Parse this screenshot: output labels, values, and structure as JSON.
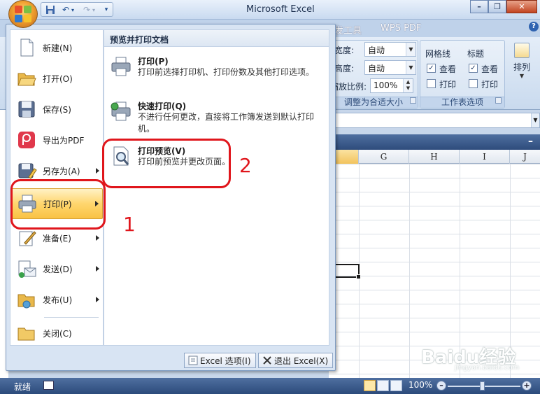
{
  "window": {
    "title": "Microsoft Excel"
  },
  "ribbon": {
    "tabs": [
      "发工具",
      "WPS PDF"
    ],
    "page_setup": {
      "width_label": "宽度:",
      "width_value": "自动",
      "height_label": "高度:",
      "height_value": "自动",
      "scale_label": "缩放比例:",
      "scale_value": "100%",
      "group_label": "调整为合适大小"
    },
    "sheet_options": {
      "gridlines_label": "网格线",
      "headings_label": "标题",
      "view_label": "查看",
      "print_label": "打印",
      "gridlines_view_checked": true,
      "gridlines_print_checked": false,
      "headings_view_checked": true,
      "headings_print_checked": false,
      "group_label": "工作表选项"
    },
    "arrange_label": "排列"
  },
  "sheet": {
    "columns": [
      "",
      "G",
      "H",
      "I",
      "J"
    ]
  },
  "office_menu": {
    "items": [
      {
        "label": "新建(N)",
        "icon": "new-document-icon",
        "has_arrow": false
      },
      {
        "label": "打开(O)",
        "icon": "open-folder-icon",
        "has_arrow": false
      },
      {
        "label": "保存(S)",
        "icon": "save-disk-icon",
        "has_arrow": false
      },
      {
        "label": "导出为PDF",
        "icon": "pdf-export-icon",
        "has_arrow": false
      },
      {
        "label": "另存为(A)",
        "icon": "save-as-icon",
        "has_arrow": true
      },
      {
        "label": "打印(P)",
        "icon": "printer-icon",
        "has_arrow": true,
        "active": true
      },
      {
        "label": "准备(E)",
        "icon": "prepare-icon",
        "has_arrow": true
      },
      {
        "label": "发送(D)",
        "icon": "send-icon",
        "has_arrow": true
      },
      {
        "label": "发布(U)",
        "icon": "publish-icon",
        "has_arrow": true
      },
      {
        "label": "关闭(C)",
        "icon": "close-folder-icon",
        "has_arrow": false
      }
    ],
    "submenu": {
      "header": "预览并打印文档",
      "items": [
        {
          "title": "打印(P)",
          "desc": "打印前选择打印机、打印份数及其他打印选项。",
          "icon": "printer-icon"
        },
        {
          "title": "快速打印(Q)",
          "desc": "不进行任何更改，直接将工作簿发送到默认打印机。",
          "icon": "quick-print-icon"
        },
        {
          "title": "打印预览(V)",
          "desc": "打印前预览并更改页面。",
          "icon": "print-preview-icon"
        }
      ]
    },
    "bottom": {
      "options_label": "Excel 选项(I)",
      "exit_label": "退出 Excel(X)"
    }
  },
  "annotations": {
    "step1": "1",
    "step2": "2"
  },
  "statusbar": {
    "ready": "就绪",
    "zoom": "100%"
  },
  "watermark": {
    "text": "Baidu经验",
    "sub": "jingyan.baidu.com"
  },
  "colors": {
    "annotation_red": "#e0161c",
    "menu_highlight": "#ffd66e",
    "statusbar": "#3a5a8a"
  }
}
